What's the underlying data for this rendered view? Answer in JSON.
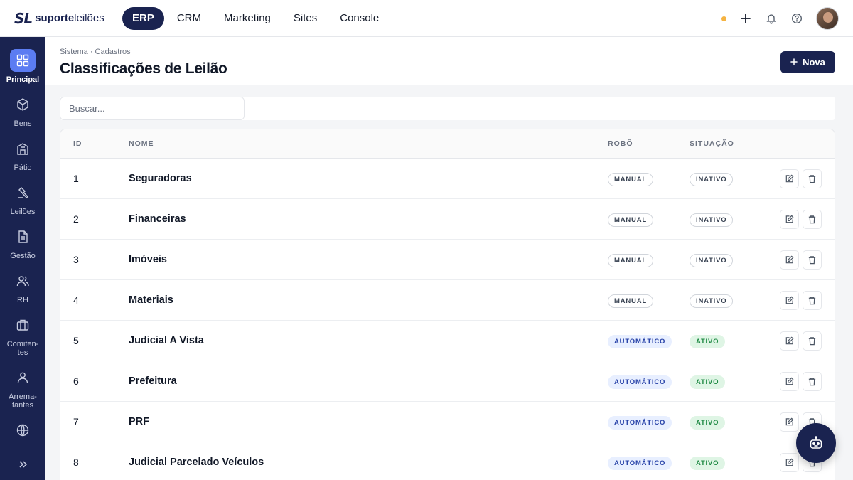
{
  "brand": {
    "mark": "SL",
    "name_bold": "suporte",
    "name_light": "leilões"
  },
  "topnav": [
    {
      "label": "ERP",
      "active": true
    },
    {
      "label": "CRM",
      "active": false
    },
    {
      "label": "Marketing",
      "active": false
    },
    {
      "label": "Sites",
      "active": false
    },
    {
      "label": "Console",
      "active": false
    }
  ],
  "sidebar": [
    {
      "label": "Principal",
      "icon": "dashboard-grid-icon",
      "active": true
    },
    {
      "label": "Bens",
      "icon": "cube-icon"
    },
    {
      "label": "Pátio",
      "icon": "building-icon"
    },
    {
      "label": "Leilões",
      "icon": "gavel-icon"
    },
    {
      "label": "Gestão",
      "icon": "document-icon"
    },
    {
      "label": "RH",
      "icon": "users-icon"
    },
    {
      "label": "Comiten-\ntes",
      "icon": "briefcase-icon"
    },
    {
      "label": "Arrema-\ntantes",
      "icon": "user-icon"
    },
    {
      "label": "",
      "icon": "globe-icon"
    }
  ],
  "page": {
    "breadcrumb": "Sistema · Cadastros",
    "title": "Classificações de Leilão",
    "new_button": "Nova"
  },
  "search": {
    "placeholder": "Buscar..."
  },
  "table": {
    "headers": {
      "id": "ID",
      "name": "NOME",
      "robot": "ROBÔ",
      "status": "SITUAÇÃO"
    },
    "rows": [
      {
        "id": "1",
        "name": "Seguradoras",
        "robot": "MANUAL",
        "status": "INATIVO"
      },
      {
        "id": "2",
        "name": "Financeiras",
        "robot": "MANUAL",
        "status": "INATIVO"
      },
      {
        "id": "3",
        "name": "Imóveis",
        "robot": "MANUAL",
        "status": "INATIVO"
      },
      {
        "id": "4",
        "name": "Materiais",
        "robot": "MANUAL",
        "status": "INATIVO"
      },
      {
        "id": "5",
        "name": "Judicial A Vista",
        "robot": "AUTOMÁTICO",
        "status": "ATIVO"
      },
      {
        "id": "6",
        "name": "Prefeitura",
        "robot": "AUTOMÁTICO",
        "status": "ATIVO"
      },
      {
        "id": "7",
        "name": "PRF",
        "robot": "AUTOMÁTICO",
        "status": "ATIVO"
      },
      {
        "id": "8",
        "name": "Judicial Parcelado Veículos",
        "robot": "AUTOMÁTICO",
        "status": "ATIVO"
      }
    ]
  },
  "colors": {
    "navy": "#1a2350",
    "accent": "#5b7cf2",
    "status_dot": "#f5b342"
  }
}
